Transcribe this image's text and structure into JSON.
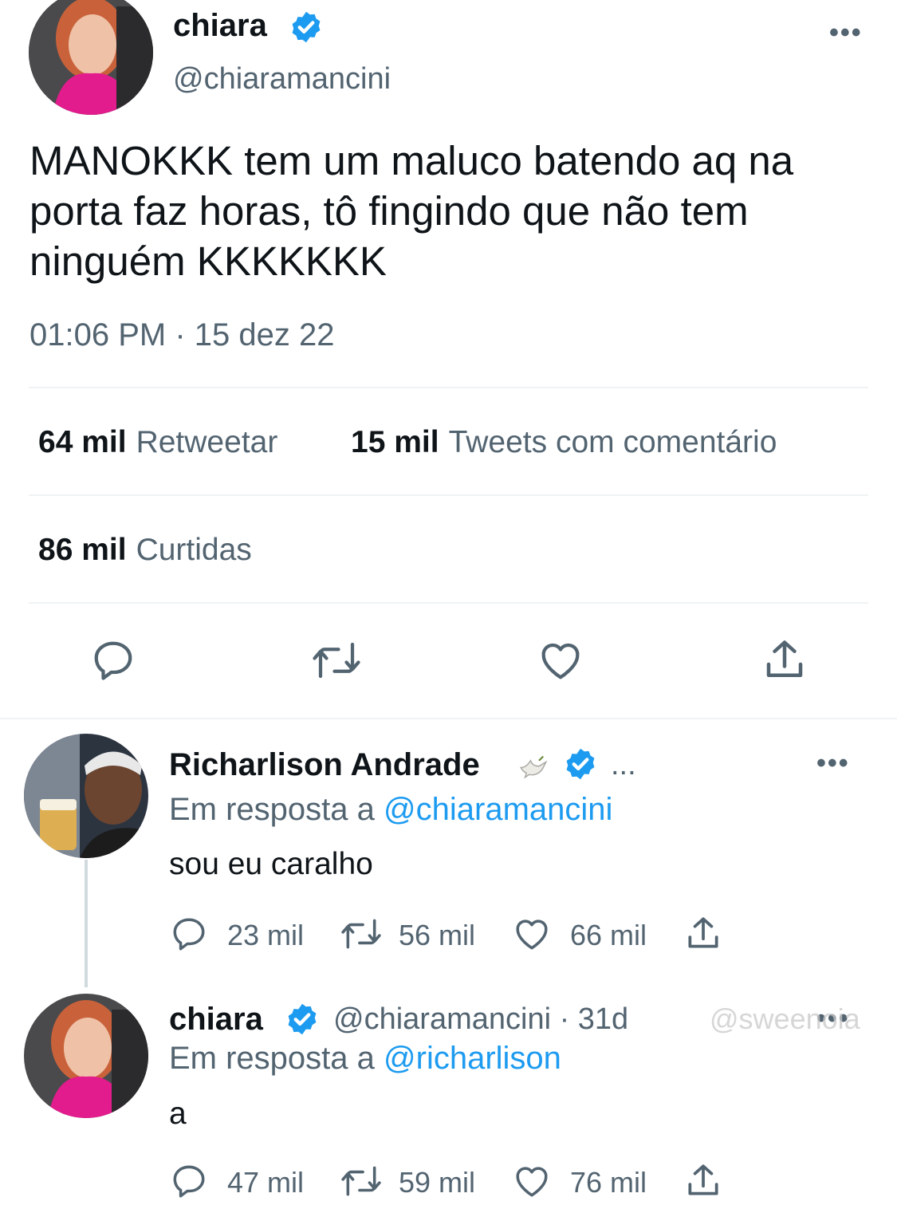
{
  "main_tweet": {
    "author_name": "chiara",
    "author_handle": "@chiaramancini",
    "text": "MANOKKK tem um maluco batendo aq na porta faz horas, tô fingindo que não tem ninguém KKKKKKK",
    "timestamp": "01:06 PM · 15 dez 22",
    "retweets_count": "64 mil",
    "retweets_label": "Retweetar",
    "quotes_count": "15 mil",
    "quotes_label": "Tweets com comentário",
    "likes_count": "86 mil",
    "likes_label": "Curtidas",
    "more_label": "•••"
  },
  "replies": [
    {
      "author_name": "Richarlison Andrade",
      "name_suffix": "...",
      "reply_prefix": "Em resposta a",
      "reply_mention": "@chiaramancini",
      "text": "sou eu caralho",
      "replies": "23 mil",
      "retweets": "56 mil",
      "likes": "66 mil",
      "more_label": "•••"
    },
    {
      "author_name": "chiara",
      "author_handle": "@chiaramancini · 31d",
      "reply_prefix": "Em resposta a",
      "reply_mention": "@richarlison",
      "text": "a",
      "replies": "47 mil",
      "retweets": "59 mil",
      "likes": "76 mil",
      "more_label": "•••"
    }
  ],
  "watermark": "@sweenoia",
  "colors": {
    "accent": "#1d9bf0",
    "secondary_text": "#536471",
    "divider": "#eff3f4"
  },
  "icons": [
    "verified-badge-icon",
    "reply-icon",
    "retweet-icon",
    "like-icon",
    "share-icon",
    "dove-emoji-icon"
  ]
}
